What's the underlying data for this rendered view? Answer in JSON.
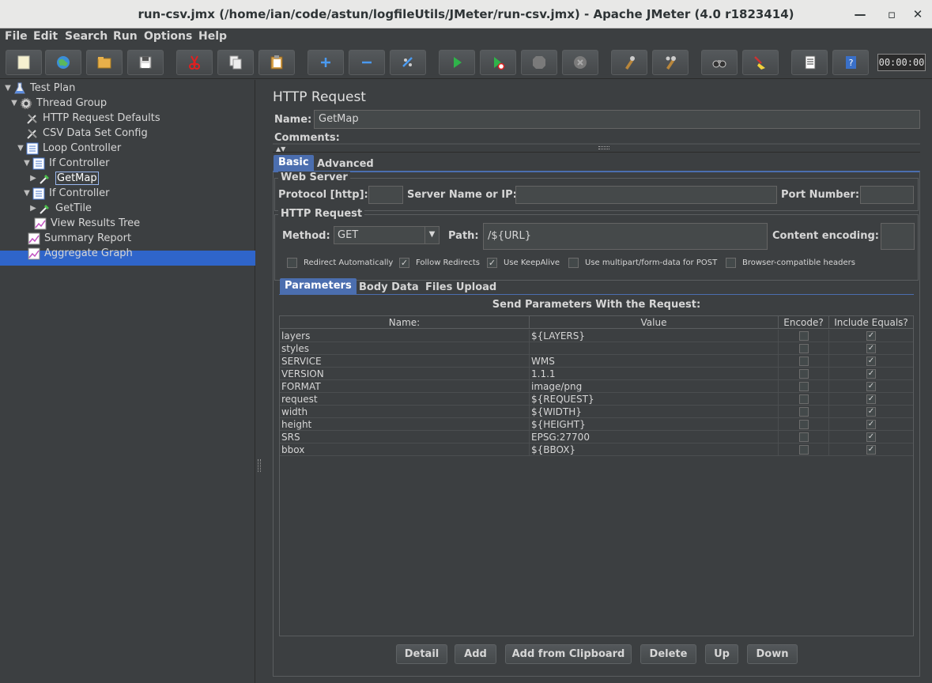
{
  "window": {
    "title": "run-csv.jmx (/home/ian/code/astun/logfileUtils/JMeter/run-csv.jmx) - Apache JMeter (4.0 r1823414)"
  },
  "menu": {
    "file": "File",
    "edit": "Edit",
    "search": "Search",
    "run": "Run",
    "options": "Options",
    "help": "Help"
  },
  "timer": "00:00:00",
  "tree": {
    "test_plan": "Test Plan",
    "thread_group": "Thread Group",
    "http_defaults": "HTTP Request Defaults",
    "csv_config": "CSV Data Set Config",
    "loop_controller": "Loop Controller",
    "if_controller_1": "If Controller",
    "getmap": "GetMap",
    "if_controller_2": "If Controller",
    "gettile": "GetTile",
    "view_results_tree": "View Results Tree",
    "summary_report": "Summary Report",
    "aggregate_graph": "Aggregate Graph"
  },
  "panel": {
    "title": "HTTP Request",
    "name_label": "Name:",
    "name_value": "GetMap",
    "comments_label": "Comments:",
    "tabs": {
      "basic": "Basic",
      "advanced": "Advanced"
    },
    "web_server": {
      "title": "Web Server",
      "protocol_label": "Protocol [http]:",
      "server_label": "Server Name or IP:",
      "port_label": "Port Number:"
    },
    "http_request": {
      "title": "HTTP Request",
      "method_label": "Method:",
      "method_value": "GET",
      "path_label": "Path:",
      "path_value": "/${URL}",
      "encoding_label": "Content encoding:"
    },
    "options": {
      "redirect_auto": "Redirect Automatically",
      "follow_redirects": "Follow Redirects",
      "keepalive": "Use KeepAlive",
      "multipart": "Use multipart/form-data for POST",
      "browser_headers": "Browser-compatible headers"
    },
    "param_tabs": {
      "parameters": "Parameters",
      "body_data": "Body Data",
      "files_upload": "Files Upload"
    },
    "table_caption": "Send Parameters With the Request:",
    "columns": {
      "name": "Name:",
      "value": "Value",
      "encode": "Encode?",
      "include_equals": "Include Equals?"
    },
    "rows": [
      {
        "name": "layers",
        "value": "${LAYERS}"
      },
      {
        "name": "styles",
        "value": ""
      },
      {
        "name": "SERVICE",
        "value": "WMS"
      },
      {
        "name": "VERSION",
        "value": "1.1.1"
      },
      {
        "name": "FORMAT",
        "value": "image/png"
      },
      {
        "name": "request",
        "value": "${REQUEST}"
      },
      {
        "name": "width",
        "value": "${WIDTH}"
      },
      {
        "name": "height",
        "value": "${HEIGHT}"
      },
      {
        "name": "SRS",
        "value": "EPSG:27700"
      },
      {
        "name": "bbox",
        "value": "${BBOX}"
      }
    ],
    "buttons": {
      "detail": "Detail",
      "add": "Add",
      "add_clipboard": "Add from Clipboard",
      "delete": "Delete",
      "up": "Up",
      "down": "Down"
    }
  }
}
